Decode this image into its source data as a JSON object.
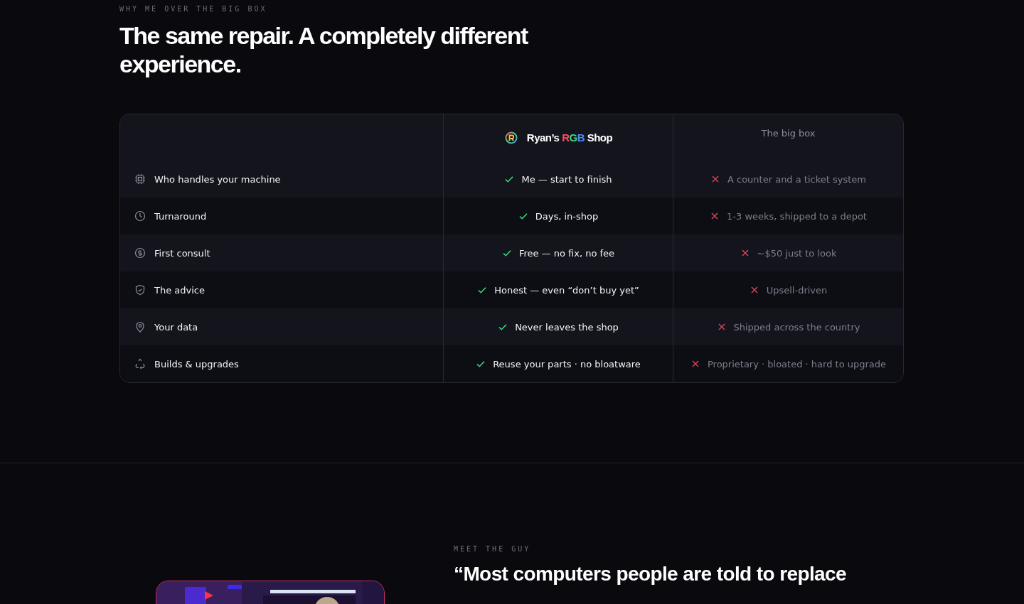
{
  "comparison": {
    "eyebrow": "WHY ME OVER THE BIG BOX",
    "heading": "The same repair. A completely different experience.",
    "brand": {
      "name": "Ryan’s",
      "highlight": "RGB",
      "suffix": "Shop"
    },
    "competitor": "The big box",
    "rows": [
      {
        "kind": "chip",
        "label": "Who handles your machine",
        "ours": "Me — start to finish",
        "theirs": "A counter and a ticket system"
      },
      {
        "kind": "clock",
        "label": "Turnaround",
        "ours": "Days, in-shop",
        "theirs": "1-3 weeks, shipped to a depot"
      },
      {
        "kind": "dollar",
        "label": "First consult",
        "ours": "Free — no fix, no fee",
        "theirs": "~$50 just to look"
      },
      {
        "kind": "shield",
        "label": "The advice",
        "ours": "Honest — even “don’t buy yet”",
        "theirs": "Upsell-driven"
      },
      {
        "kind": "pin",
        "label": "Your data",
        "ours": "Never leaves the shop",
        "theirs": "Shipped across the country"
      },
      {
        "kind": "recycle",
        "label": "Builds & upgrades",
        "ours": "Reuse your parts · no bloatware",
        "theirs": "Proprietary · bloated · hard to upgrade"
      }
    ]
  },
  "about": {
    "eyebrow": "MEET THE GUY",
    "quote": "“Most computers people are told to replace"
  }
}
